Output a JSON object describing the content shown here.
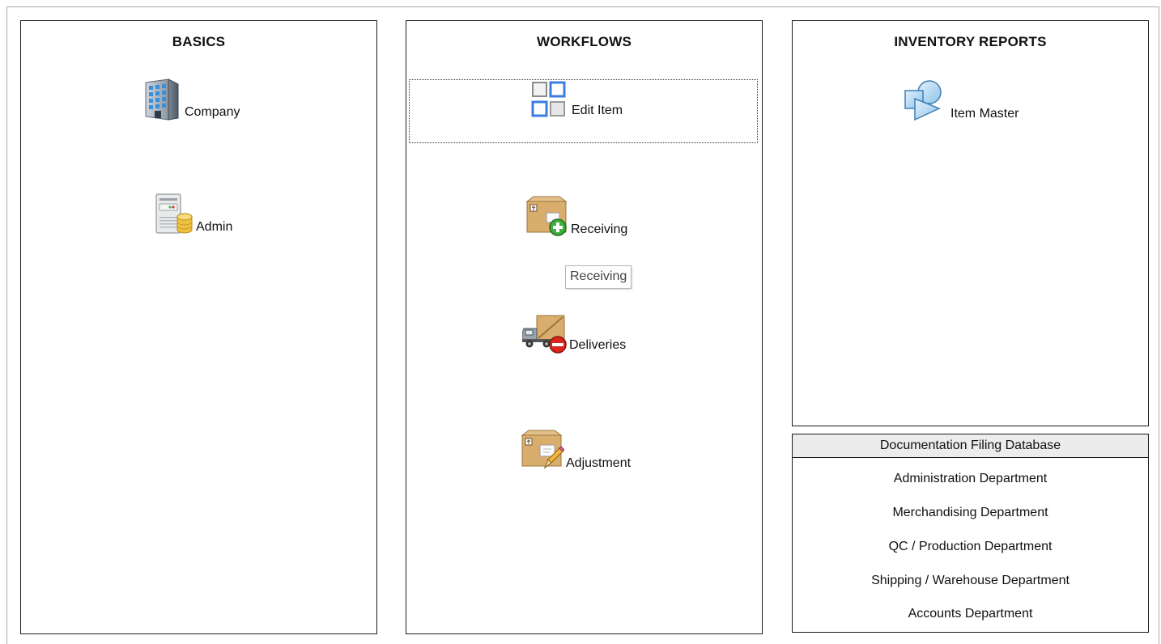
{
  "basics": {
    "title": "BASICS",
    "items": [
      {
        "label": "Company",
        "icon": "building-icon"
      },
      {
        "label": "Admin",
        "icon": "server-database-icon"
      }
    ]
  },
  "workflows": {
    "title": "WORKFLOWS",
    "items": [
      {
        "label": "Edit Item",
        "icon": "edit-grid-icon"
      },
      {
        "label": "Receiving",
        "icon": "box-add-icon"
      },
      {
        "label": "Deliveries",
        "icon": "truck-remove-icon"
      },
      {
        "label": "Adjustment",
        "icon": "box-edit-icon"
      }
    ],
    "tooltip": "Receiving"
  },
  "inventory_reports": {
    "title": "INVENTORY REPORTS",
    "items": [
      {
        "label": "Item Master",
        "icon": "shapes-report-icon"
      }
    ]
  },
  "documentation": {
    "title": "Documentation Filing Database",
    "links": [
      "Administration Department",
      "Merchandising Department",
      "QC / Production Department",
      "Shipping / Warehouse Department",
      "Accounts Department"
    ]
  }
}
